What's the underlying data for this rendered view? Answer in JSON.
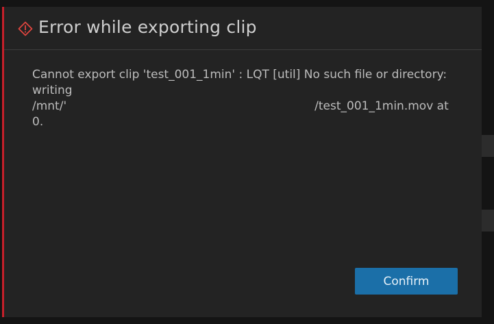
{
  "dialog": {
    "title": "Error while exporting clip",
    "icon": "warning-diamond-icon",
    "accent_color": "#c8202a",
    "message": {
      "line1": "Cannot export clip 'test_001_1min' : LQT [util] No such file or directory:",
      "line2": "writing",
      "line3_prefix": "/mnt/'",
      "line3_suffix": "/test_001_1min.mov at",
      "line4": "0."
    },
    "confirm_label": "Confirm",
    "confirm_color": "#1b6fa8"
  }
}
